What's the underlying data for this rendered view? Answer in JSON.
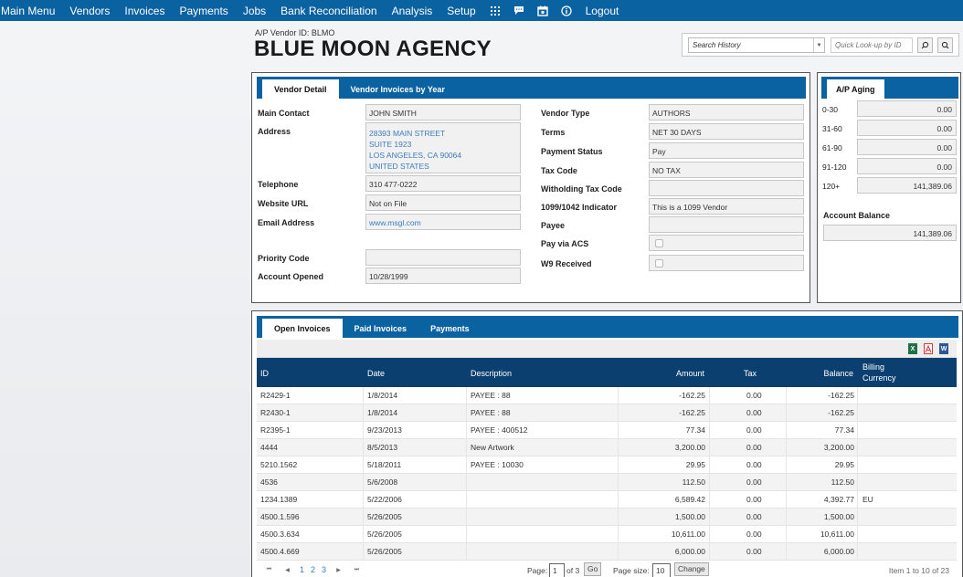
{
  "nav": {
    "items": [
      "Main Menu",
      "Vendors",
      "Invoices",
      "Payments",
      "Jobs",
      "Bank Reconciliation",
      "Analysis",
      "Setup"
    ],
    "logout": "Logout"
  },
  "header": {
    "vendor_id_label": "A/P Vendor ID: BLMO",
    "vendor_name": "BLUE MOON AGENCY"
  },
  "search": {
    "history_placeholder": "Search History",
    "lookup_placeholder": "Quick Look-up by ID"
  },
  "detail": {
    "tabs": [
      "Vendor Detail",
      "Vendor Invoices by Year"
    ],
    "left": {
      "main_contact": {
        "label": "Main Contact",
        "value": "JOHN SMITH"
      },
      "address": {
        "label": "Address",
        "lines": [
          "28393 MAIN STREET",
          "SUITE 1923",
          "LOS ANGELES, CA 90064",
          "UNITED STATES"
        ]
      },
      "telephone": {
        "label": "Telephone",
        "value": "310 477-0222"
      },
      "website": {
        "label": "Website URL",
        "value": "Not on File"
      },
      "email": {
        "label": "Email Address",
        "value": "www.msgl.com"
      },
      "priority": {
        "label": "Priority Code",
        "value": ""
      },
      "opened": {
        "label": "Account Opened",
        "value": "10/28/1999"
      }
    },
    "right": {
      "vendor_type": {
        "label": "Vendor Type",
        "value": "AUTHORS"
      },
      "terms": {
        "label": "Terms",
        "value": "NET 30 DAYS"
      },
      "payment_status": {
        "label": "Payment Status",
        "value": "Pay"
      },
      "tax_code": {
        "label": "Tax Code",
        "value": "NO TAX"
      },
      "withholding": {
        "label": "Witholding Tax Code",
        "value": ""
      },
      "indicator": {
        "label": "1099/1042 Indicator",
        "value": "This is a 1099 Vendor"
      },
      "payee": {
        "label": "Payee",
        "value": ""
      },
      "pay_via_acs": {
        "label": "Pay via ACS"
      },
      "w9": {
        "label": "W9 Received"
      }
    }
  },
  "aging": {
    "tab": "A/P Aging",
    "buckets": [
      {
        "label": "0-30",
        "value": "0.00"
      },
      {
        "label": "31-60",
        "value": "0.00"
      },
      {
        "label": "61-90",
        "value": "0.00"
      },
      {
        "label": "91-120",
        "value": "0.00"
      },
      {
        "label": "120+",
        "value": "141,389.06"
      }
    ],
    "balance_label": "Account Balance",
    "balance_value": "141,389.06"
  },
  "invoices": {
    "tabs": [
      "Open Invoices",
      "Paid Invoices",
      "Payments"
    ],
    "columns": [
      "ID",
      "Date",
      "Description",
      "Amount",
      "Tax",
      "Balance",
      "Billing",
      "Currency"
    ],
    "rows": [
      [
        "R2429-1",
        "1/8/2014",
        "PAYEE : 88",
        "-162.25",
        "0.00",
        "-162.25",
        ""
      ],
      [
        "R2430-1",
        "1/8/2014",
        "PAYEE : 88",
        "-162.25",
        "0.00",
        "-162.25",
        ""
      ],
      [
        "R2395-1",
        "9/23/2013",
        "PAYEE : 400512",
        "77.34",
        "0.00",
        "77.34",
        ""
      ],
      [
        "4444",
        "8/5/2013",
        "New Artwork",
        "3,200.00",
        "0.00",
        "3,200.00",
        ""
      ],
      [
        "5210.1562",
        "5/18/2011",
        "PAYEE : 10030",
        "29.95",
        "0.00",
        "29.95",
        ""
      ],
      [
        "4536",
        "5/6/2008",
        "",
        "112.50",
        "0.00",
        "112.50",
        ""
      ],
      [
        "1234.1389",
        "5/22/2006",
        "",
        "6,589.42",
        "0.00",
        "4,392.77",
        "EU"
      ],
      [
        "4500.1.596",
        "5/26/2005",
        "",
        "1,500.00",
        "0.00",
        "1,500.00",
        ""
      ],
      [
        "4500.3.634",
        "5/26/2005",
        "",
        "10,611.00",
        "0.00",
        "10,611.00",
        ""
      ],
      [
        "4500.4.669",
        "5/26/2005",
        "",
        "6,000.00",
        "0.00",
        "6,000.00",
        ""
      ]
    ],
    "pager": {
      "pages": [
        "1",
        "2",
        "3"
      ],
      "page_label": "Page:",
      "page_value": "1",
      "of_label": "of 3",
      "go": "Go",
      "size_label": "Page size:",
      "size_value": "10",
      "change": "Change",
      "summary": "Item 1 to 10 of 23"
    }
  }
}
